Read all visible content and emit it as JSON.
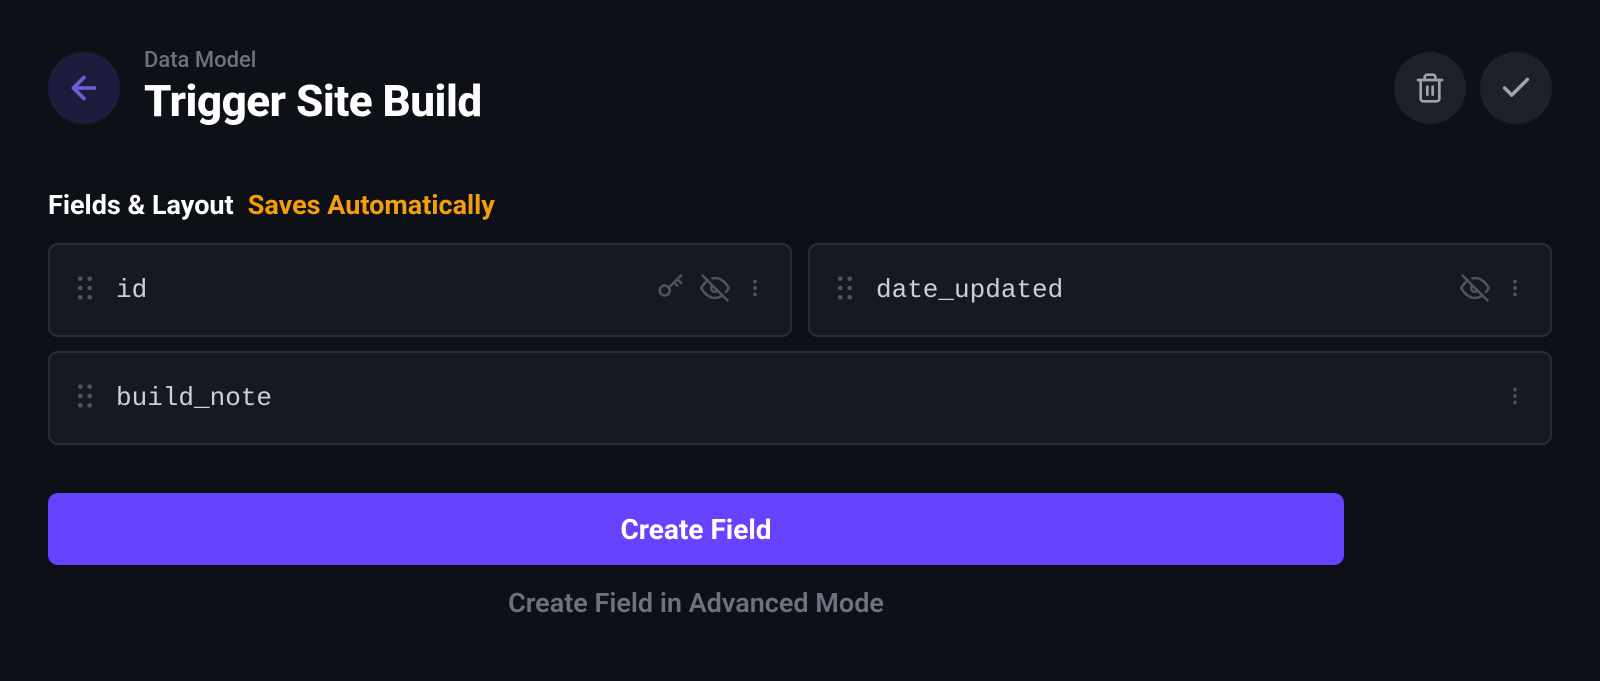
{
  "header": {
    "breadcrumb": "Data Model",
    "title": "Trigger Site Build"
  },
  "section": {
    "title": "Fields & Layout",
    "subtitle": "Saves Automatically"
  },
  "fields": [
    {
      "name": "id",
      "has_key": true,
      "has_hidden": true
    },
    {
      "name": "date_updated",
      "has_key": false,
      "has_hidden": true
    },
    {
      "name": "build_note",
      "has_key": false,
      "has_hidden": false
    }
  ],
  "actions": {
    "create_field": "Create Field",
    "advanced_mode": "Create Field in Advanced Mode"
  }
}
